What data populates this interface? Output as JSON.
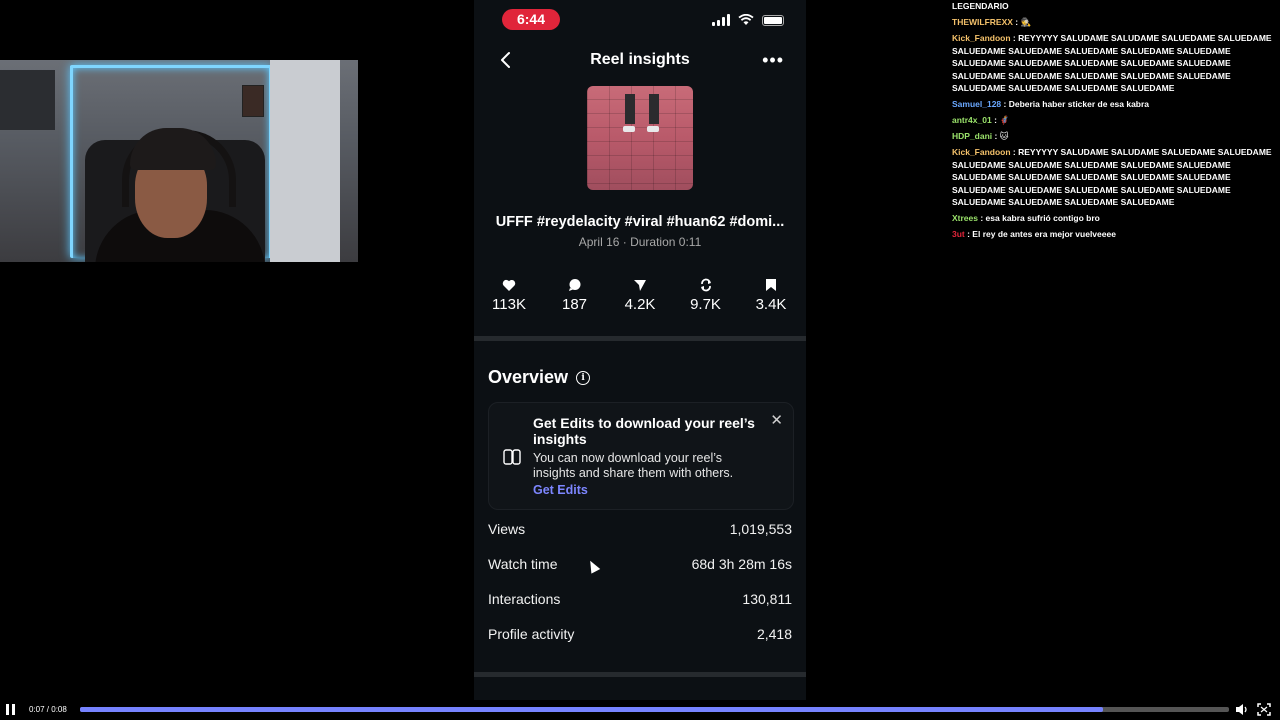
{
  "phone": {
    "status_time": "6:44",
    "nav_title": "Reel insights",
    "reel_title": "UFFF #reydelacity #viral #huan62 #domi...",
    "reel_meta": "April 16 · Duration 0:11",
    "stats": [
      {
        "icon": "heart-icon",
        "value": "113K"
      },
      {
        "icon": "comment-icon",
        "value": "187"
      },
      {
        "icon": "share-icon",
        "value": "4.2K"
      },
      {
        "icon": "repost-icon",
        "value": "9.7K"
      },
      {
        "icon": "save-icon",
        "value": "3.4K"
      }
    ],
    "overview_title": "Overview",
    "promo": {
      "title": "Get Edits to download your reel’s insights",
      "body": "You can now download your reel’s insights and share them with others.",
      "link": "Get Edits"
    },
    "metrics": [
      {
        "label": "Views",
        "value": "1,019,553"
      },
      {
        "label": "Watch time",
        "value": "68d 3h 28m 16s"
      },
      {
        "label": "Interactions",
        "value": "130,811"
      },
      {
        "label": "Profile activity",
        "value": "2,418"
      }
    ]
  },
  "chat": {
    "messages": [
      {
        "user": "",
        "text": "LEGENDARIO",
        "color": "#ffffff"
      },
      {
        "user": "THEWILFREXX",
        "text": " : 🕵",
        "color": "#f5c26b"
      },
      {
        "user": "Kick_Fandoon",
        "text": " : REYYYYY SALUDAME SALUDAME SALUEDAME SALUEDAME SALUEDAME SALUEDAME SALUEDAME SALUEDAME SALUEDAME SALUEDAME SALUEDAME SALUEDAME SALUEDAME SALUEDAME SALUEDAME SALUEDAME SALUEDAME SALUEDAME SALUEDAME SALUEDAME SALUEDAME SALUEDAME SALUEDAME",
        "color": "#f5c26b"
      },
      {
        "user": "Samuel_128",
        "text": " : Deberia haber sticker de esa kabra",
        "color": "#6aa8ff"
      },
      {
        "user": "antr4x_01",
        "text": " : 🦸",
        "color": "#9be36b"
      },
      {
        "user": "HDP_dani",
        "text": " : 🐱",
        "color": "#9be36b"
      },
      {
        "user": "Kick_Fandoon",
        "text": " : REYYYYY SALUDAME SALUDAME SALUEDAME SALUEDAME SALUEDAME SALUEDAME SALUEDAME SALUEDAME SALUEDAME SALUEDAME SALUEDAME SALUEDAME SALUEDAME SALUEDAME SALUEDAME SALUEDAME SALUEDAME SALUEDAME SALUEDAME SALUEDAME SALUEDAME SALUEDAME SALUEDAME",
        "color": "#f5c26b"
      },
      {
        "user": "Xtrees",
        "text": " : esa kabra sufrió contigo bro",
        "color": "#9be36b"
      },
      {
        "user": "3ut",
        "text": " : El rey de antes era mejor vuelveeee",
        "color": "#e0253a"
      }
    ]
  },
  "player": {
    "time": "0:07 / 0:08",
    "progress": 0.89
  },
  "colors": {
    "accent": "#7683ff",
    "clock_pill": "#e0253a",
    "link": "#7d86ff",
    "phone_bg": "#0c1014"
  }
}
